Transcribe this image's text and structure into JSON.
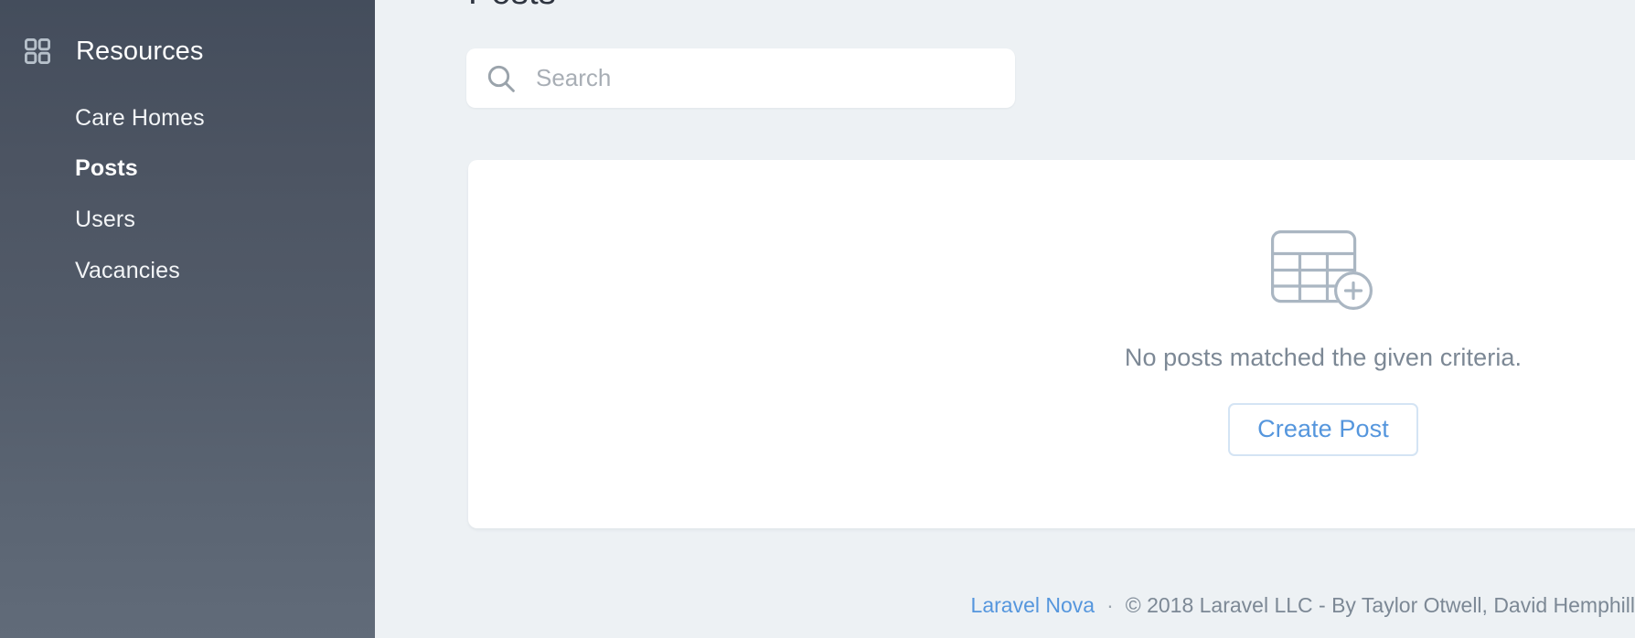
{
  "sidebar": {
    "heading": {
      "label": "Resources",
      "icon": "grid-icon"
    },
    "items": [
      {
        "label": "Care Homes",
        "active": false
      },
      {
        "label": "Posts",
        "active": true
      },
      {
        "label": "Users",
        "active": false
      },
      {
        "label": "Vacancies",
        "active": false
      }
    ]
  },
  "main": {
    "page_title": "Posts",
    "search": {
      "value": "",
      "placeholder": "Search",
      "icon": "search-icon"
    },
    "empty_state": {
      "icon": "table-add-icon",
      "message": "No posts matched the given criteria.",
      "create_button_label": "Create Post"
    }
  },
  "footer": {
    "link_label": "Laravel Nova",
    "separator": "·",
    "copyright": "© 2018 Laravel LLC - By Taylor Otwell, David Hemphill"
  },
  "colors": {
    "sidebar_top": "#444d5c",
    "sidebar_bottom": "#616b79",
    "page_background": "#edf1f4",
    "card_background": "#ffffff",
    "accent_blue": "#5596dd",
    "muted_text": "#7c8895",
    "icon_muted": "#aab6c2"
  }
}
